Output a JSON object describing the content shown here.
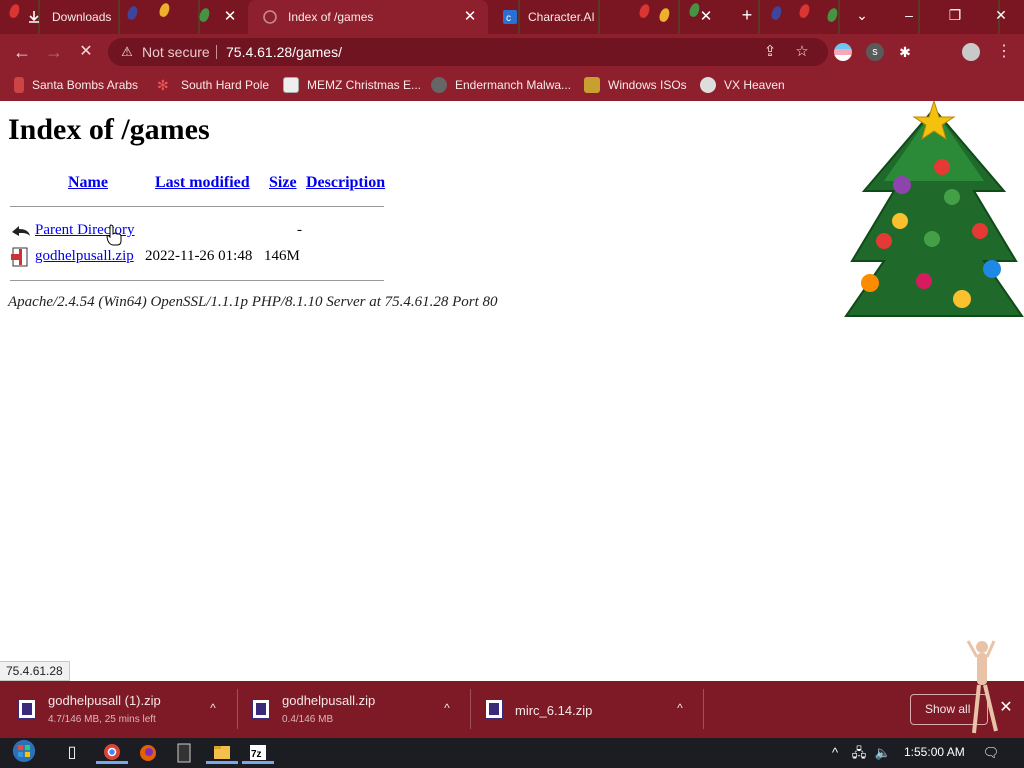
{
  "tabs": [
    {
      "title": "Downloads",
      "active": false
    },
    {
      "title": "Index of /games",
      "active": true
    },
    {
      "title": "Character.AI",
      "active": false
    }
  ],
  "toolbar": {
    "security_label": "Not secure",
    "url": "75.4.61.28/games/"
  },
  "bookmarks": [
    {
      "label": "Santa Bombs Arabs"
    },
    {
      "label": "South Hard Pole"
    },
    {
      "label": "MEMZ Christmas E..."
    },
    {
      "label": "Endermanch Malwa..."
    },
    {
      "label": "Windows ISOs"
    },
    {
      "label": "VX Heaven"
    }
  ],
  "page": {
    "title": "Index of /games",
    "columns": {
      "name": "Name",
      "modified": "Last modified",
      "size": "Size",
      "description": "Description"
    },
    "rows": [
      {
        "name": "Parent Directory",
        "modified": "",
        "size": "-",
        "icon": "back-arrow-icon"
      },
      {
        "name": "godhelpusall.zip",
        "modified": "2022-11-26 01:48",
        "size": "146M",
        "icon": "compressed-file-icon"
      }
    ],
    "address": "Apache/2.4.54 (Win64) OpenSSL/1.1.1p PHP/8.1.10 Server at 75.4.61.28 Port 80"
  },
  "status_bubble": "75.4.61.28",
  "downloads": {
    "items": [
      {
        "filename": "godhelpusall (1).zip",
        "progress": "4.7/146 MB, 25 mins left"
      },
      {
        "filename": "godhelpusall.zip",
        "progress": "0.4/146 MB"
      },
      {
        "filename": "mirc_6.14.zip",
        "progress": ""
      }
    ],
    "show_all_label": "Show all"
  },
  "taskbar": {
    "clock": "1:55:00 AM"
  },
  "colors": {
    "chrome_frame": "#8e1f2c",
    "tab_strip": "#7a1622",
    "link": "#0000ee",
    "download_bar": "#7d1a26"
  }
}
